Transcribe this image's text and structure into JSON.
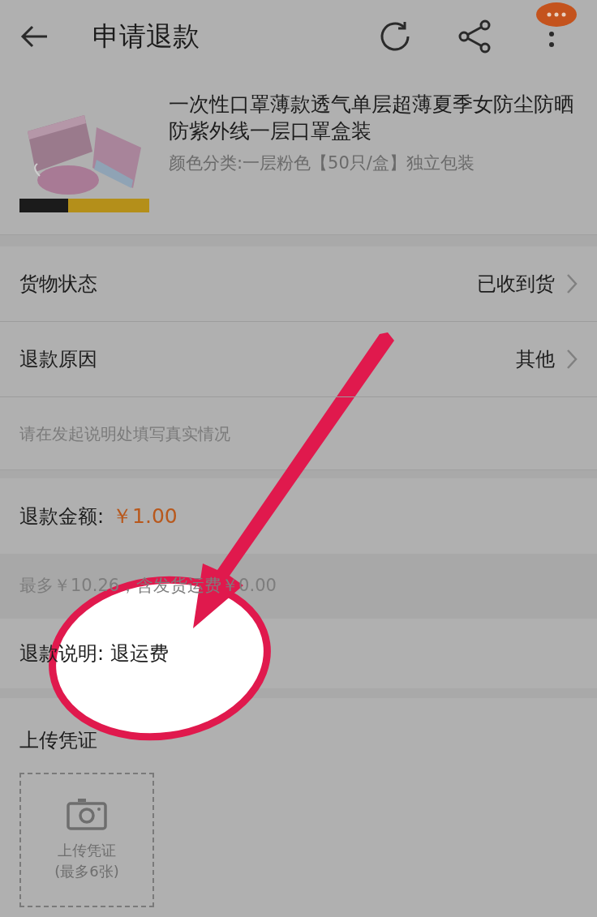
{
  "header": {
    "title": "申请退款"
  },
  "product": {
    "title": "一次性口罩薄款透气单层超薄夏季女防尘防晒防紫外线一层口罩盒装",
    "spec": "颜色分类:一层粉色【50只/盒】独立包装"
  },
  "rows": [
    {
      "label": "货物状态",
      "value": "已收到货"
    },
    {
      "label": "退款原因",
      "value": "其他"
    }
  ],
  "hint": "请在发起说明处填写真实情况",
  "amount": {
    "label": "退款金额:",
    "value": "￥1.00"
  },
  "max_note": "最多￥10.26，含发货运费￥0.00",
  "note": {
    "label": "退款说明:",
    "value": "退运费"
  },
  "upload": {
    "title": "上传凭证",
    "button_label": "上传凭证",
    "button_sub": "(最多6张)"
  }
}
